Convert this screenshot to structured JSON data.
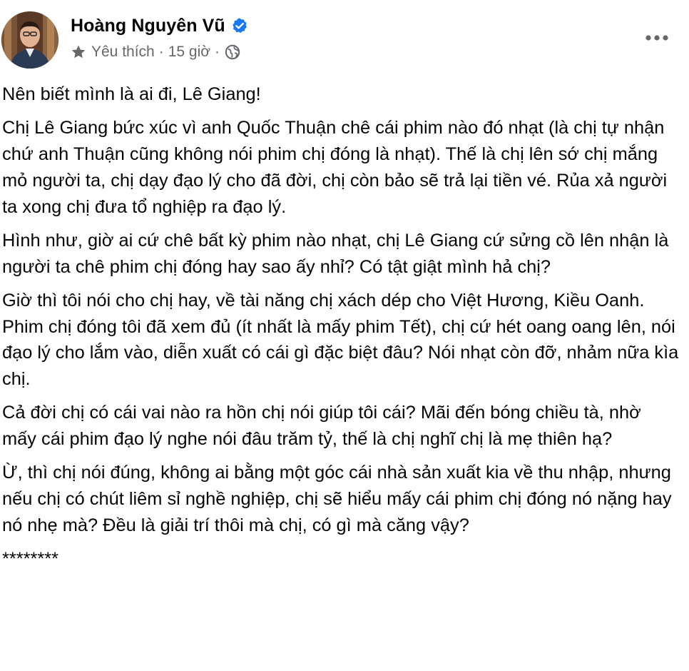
{
  "post": {
    "author": {
      "name": "Hoàng Nguyên Vũ",
      "verified": true,
      "avatar_icon": "profile-photo"
    },
    "meta": {
      "badge_icon": "star-icon",
      "badge_label": "Yêu thích",
      "separator": "·",
      "time": "15 giờ",
      "audience_icon": "globe-icon"
    },
    "more_icon": "more-options-icon",
    "paragraphs": [
      "Nên biết mình là ai đi, Lê Giang!",
      "Chị Lê Giang bức xúc vì anh Quốc Thuận chê cái phim nào đó nhạt (là chị tự nhận chứ anh Thuận cũng không nói phim chị đóng là nhạt). Thế là chị lên sớ chị mắng mỏ người ta, chị dạy đạo lý cho đã đời, chị còn bảo sẽ trả lại tiền vé. Rủa xả người ta xong chị đưa tổ nghiệp ra đạo lý.",
      "Hình như, giờ ai cứ chê bất kỳ phim nào nhạt, chị Lê Giang cứ sửng cồ lên nhận là người ta chê phim chị đóng hay sao ấy nhỉ? Có tật giật mình hả chị?",
      "Giờ thì tôi nói cho chị hay, về tài năng chị xách dép cho Việt Hương, Kiều Oanh. Phim chị đóng tôi đã xem đủ (ít nhất là mấy phim Tết), chị cứ hét oang oang lên, nói đạo lý cho lắm vào, diễn xuất có cái gì đặc biệt đâu? Nói nhạt còn đỡ, nhảm nữa kìa chị.",
      "Cả đời chị có cái vai nào ra hồn chị nói giúp tôi cái? Mãi đến bóng chiều tà, nhờ mấy cái phim đạo lý nghe nói đâu trăm tỷ, thế là chị nghĩ chị là mẹ thiên hạ?",
      "Ừ, thì chị nói đúng, không ai bằng một góc cái nhà sản xuất kia về thu nhập, nhưng nếu chị có chút liêm sỉ nghề nghiệp, chị sẽ hiểu mấy cái phim chị đóng nó nặng hay nó nhẹ mà? Đều là giải trí thôi mà chị, có gì mà căng vậy?",
      "********"
    ]
  },
  "colors": {
    "text": "#050505",
    "secondary_text": "#65676b",
    "verified_blue": "#1877f2"
  }
}
